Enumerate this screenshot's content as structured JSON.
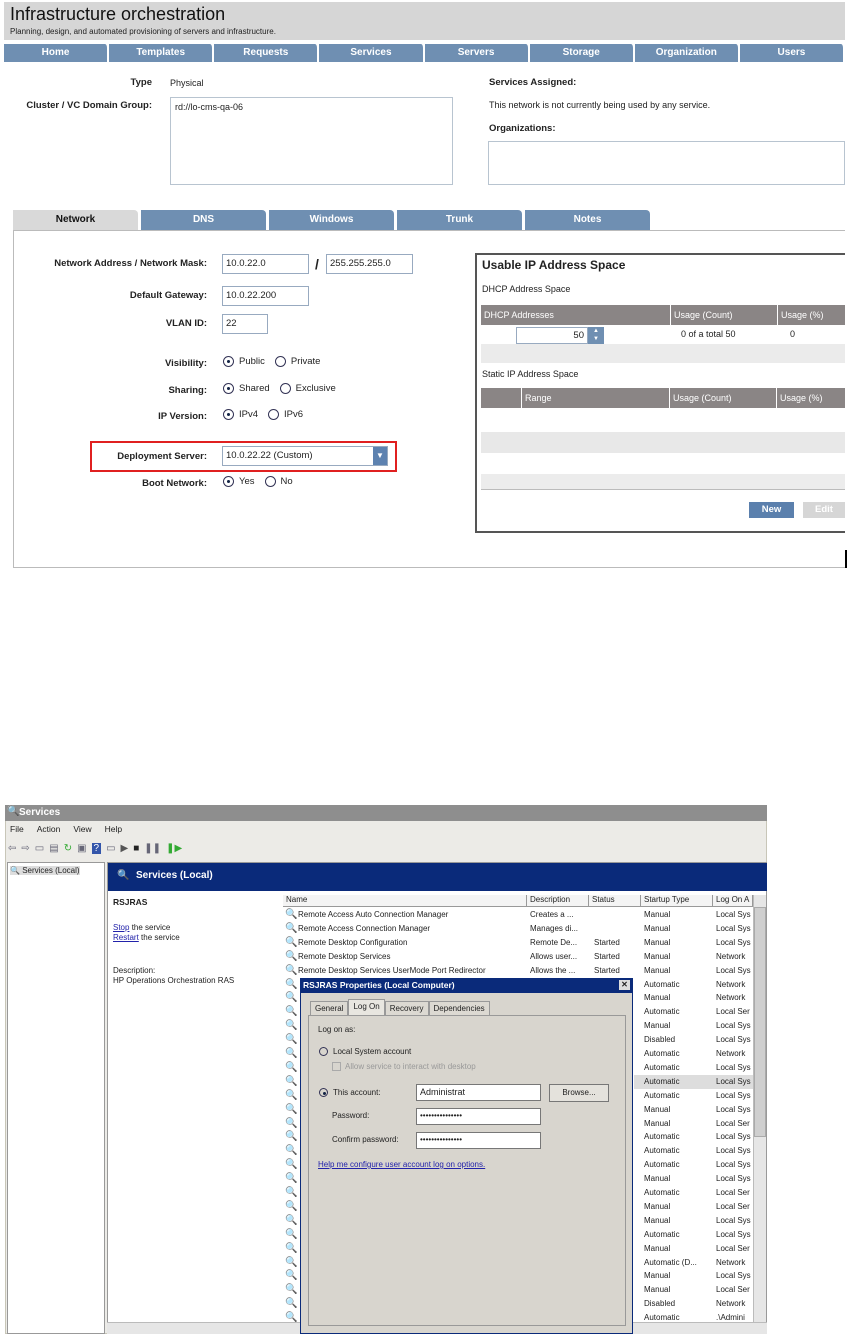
{
  "orch": {
    "title": "Infrastructure orchestration",
    "subtitle": "Planning, design, and automated provisioning of servers and infrastructure.",
    "nav": [
      "Home",
      "Templates",
      "Requests",
      "Services",
      "Servers",
      "Storage",
      "Organization",
      "Users"
    ],
    "type_label": "Type",
    "type_value": "Physical",
    "cluster_label": "Cluster / VC Domain Group:",
    "cluster_value": "rd://lo-cms-qa-06",
    "services_assigned_label": "Services Assigned:",
    "services_assigned_text": "This network is not currently being used by any service.",
    "organizations_label": "Organizations:",
    "tabs": [
      "Network",
      "DNS",
      "Windows",
      "Trunk",
      "Notes"
    ],
    "net_label": "Network Address / Network Mask:",
    "net_address": "10.0.22.0",
    "slash": "/",
    "net_mask": "255.255.255.0",
    "gw_label": "Default Gateway:",
    "gw_value": "10.0.22.200",
    "vlan_label": "VLAN ID:",
    "vlan_value": "22",
    "visibility_label": "Visibility:",
    "visibility_options": [
      "Public",
      "Private"
    ],
    "sharing_label": "Sharing:",
    "sharing_options": [
      "Shared",
      "Exclusive"
    ],
    "ipver_label": "IP Version:",
    "ipver_options": [
      "IPv4",
      "IPv6"
    ],
    "deploy_label": "Deployment Server:",
    "deploy_value": "10.0.22.22 (Custom)",
    "boot_label": "Boot Network:",
    "boot_options": [
      "Yes",
      "No"
    ],
    "usable": {
      "title": "Usable IP Address Space",
      "dhcp_label": "DHCP Address Space",
      "dhcp_headers": [
        "DHCP Addresses",
        "Usage (Count)",
        "Usage (%)"
      ],
      "dhcp_value": "50",
      "dhcp_count": "0 of a total 50",
      "dhcp_pct": "0",
      "static_label": "Static IP Address Space",
      "static_headers": [
        "Range",
        "Usage (Count)",
        "Usage (%)"
      ],
      "new": "New",
      "edit": "Edit"
    },
    "highlight_color": "#e02020"
  },
  "services": {
    "title": "Services",
    "menu": [
      "File",
      "Action",
      "View",
      "Help"
    ],
    "tree_item": "Services (Local)",
    "header": "Services (Local)",
    "selected": "RSJRAS",
    "stop": "Stop",
    "stop_rest": " the service",
    "restart": "Restart",
    "restart_rest": " the service",
    "desc_label": "Description:",
    "desc_text": "HP Operations Orchestration RAS",
    "columns": [
      "Name",
      "Description",
      "Status",
      "Startup Type",
      "Log On A"
    ],
    "rows": [
      [
        "Remote Access Auto Connection Manager",
        "Creates a ...",
        "",
        "Manual",
        "Local Sys"
      ],
      [
        "Remote Access Connection Manager",
        "Manages di...",
        "",
        "Manual",
        "Local Sys"
      ],
      [
        "Remote Desktop Configuration",
        "Remote De...",
        "Started",
        "Manual",
        "Local Sys"
      ],
      [
        "Remote Desktop Services",
        "Allows user...",
        "Started",
        "Manual",
        "Network"
      ],
      [
        "Remote Desktop Services UserMode Port Redirector",
        "Allows the ...",
        "Started",
        "Manual",
        "Local Sys"
      ],
      [
        "",
        "",
        "",
        "Automatic",
        "Network"
      ],
      [
        "",
        "",
        "",
        "Manual",
        "Network"
      ],
      [
        "",
        "",
        "",
        "Automatic",
        "Local Ser"
      ],
      [
        "",
        "",
        "",
        "Manual",
        "Local Sys"
      ],
      [
        "",
        "",
        "",
        "Disabled",
        "Local Sys"
      ],
      [
        "",
        "",
        "",
        "Automatic",
        "Network"
      ],
      [
        "",
        "",
        "",
        "Automatic",
        "Local Sys"
      ],
      [
        "",
        "",
        "",
        "Automatic",
        "Local Sys"
      ],
      [
        "",
        "",
        "",
        "Automatic",
        "Local Sys"
      ],
      [
        "",
        "",
        "",
        "Manual",
        "Local Sys"
      ],
      [
        "",
        "",
        "",
        "Manual",
        "Local Ser"
      ],
      [
        "",
        "",
        "",
        "Automatic",
        "Local Sys"
      ],
      [
        "",
        "",
        "",
        "Automatic",
        "Local Sys"
      ],
      [
        "",
        "",
        "",
        "Automatic",
        "Local Sys"
      ],
      [
        "",
        "",
        "",
        "Manual",
        "Local Sys"
      ],
      [
        "",
        "",
        "",
        "Automatic",
        "Local Ser"
      ],
      [
        "",
        "",
        "",
        "Manual",
        "Local Ser"
      ],
      [
        "",
        "",
        "",
        "Manual",
        "Local Sys"
      ],
      [
        "",
        "",
        "",
        "Automatic",
        "Local Sys"
      ],
      [
        "",
        "",
        "",
        "Manual",
        "Local Ser"
      ],
      [
        "",
        "",
        "",
        "Automatic (D...",
        "Network"
      ],
      [
        "",
        "",
        "",
        "Manual",
        "Local Sys"
      ],
      [
        "",
        "",
        "",
        "Manual",
        "Local Ser"
      ],
      [
        "",
        "",
        "",
        "Disabled",
        "Network"
      ],
      [
        "",
        "",
        "",
        "Automatic",
        ".\\Admini"
      ]
    ],
    "dialog": {
      "title": "RSJRAS Properties (Local Computer)",
      "tabs": [
        "General",
        "Log On",
        "Recovery",
        "Dependencies"
      ],
      "logon_as": "Log on as:",
      "local_system": "Local System account",
      "allow_interact": "Allow service to interact with desktop",
      "this_account": "This account:",
      "account_value": "Administrat",
      "browse": "Browse...",
      "password_label": "Password:",
      "password_value": "•••••••••••••••",
      "confirm_label": "Confirm password:",
      "confirm_value": "•••••••••••••••",
      "help_link": "Help me configure user account log on options."
    }
  }
}
